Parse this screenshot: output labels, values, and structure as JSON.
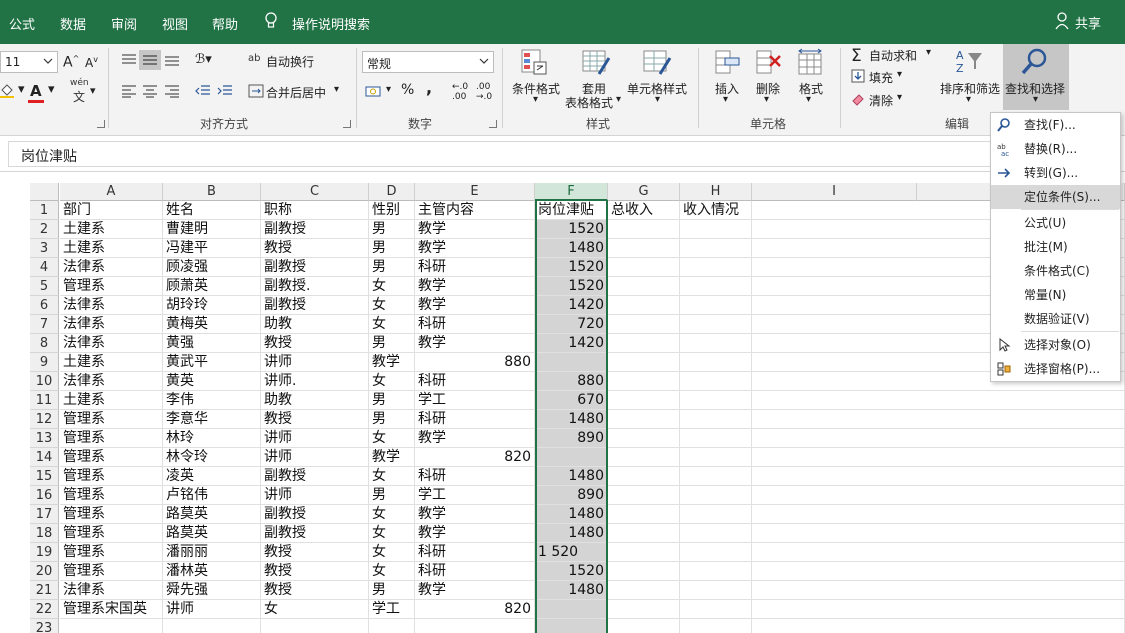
{
  "menu_tabs": [
    "公式",
    "数据",
    "审阅",
    "视图",
    "帮助"
  ],
  "tell_me": "操作说明搜索",
  "share": "共享",
  "ribbon": {
    "font_size": "11",
    "wen_label": "wén",
    "wrap_text": "自动换行",
    "merge_center": "合并后居中",
    "align_group": "对齐方式",
    "number_format": "常规",
    "percent": "%",
    "comma": ",",
    "number_group": "数字",
    "conditional_format": "条件格式",
    "table_format_1": "套用",
    "table_format_2": "表格格式",
    "cell_styles": "单元格样式",
    "styles_group": "样式",
    "insert": "插入",
    "delete": "删除",
    "format": "格式",
    "cells_group": "单元格",
    "autosum": "自动求和",
    "fill": "填充",
    "clear": "清除",
    "sort_filter": "排序和筛选",
    "find_select": "查找和选择",
    "edit_group": "编辑"
  },
  "formula_bar": {
    "value": "岗位津贴"
  },
  "columns": [
    "A",
    "B",
    "C",
    "D",
    "E",
    "F",
    "G",
    "H",
    "I"
  ],
  "rows": [
    [
      "部门",
      "姓名",
      "职称",
      "性别",
      "主管内容",
      "岗位津贴",
      "总收入",
      "收入情况"
    ],
    [
      "土建系",
      "曹建明",
      "副教授",
      "男",
      "教学",
      "1520",
      "",
      ""
    ],
    [
      "土建系",
      "冯建平",
      "教授",
      "男",
      "教学",
      "1480",
      "",
      ""
    ],
    [
      "法律系",
      "顾凌强",
      "副教授",
      "男",
      "科研",
      "1520",
      "",
      ""
    ],
    [
      "管理系",
      "顾萧英",
      "副教授.",
      "女",
      "教学",
      "1520",
      "",
      ""
    ],
    [
      "法律系",
      "胡玲玲",
      "副教授",
      "女",
      "教学",
      "1420",
      "",
      ""
    ],
    [
      "法律系",
      "黄梅英",
      "助教",
      "女",
      "科研",
      "720",
      "",
      ""
    ],
    [
      "法律系",
      "黄强",
      "教授",
      "男",
      "教学",
      "1420",
      "",
      ""
    ],
    [
      "土建系",
      "黄武平",
      "讲师",
      "教学",
      "880",
      "",
      "",
      ""
    ],
    [
      "法律系",
      "黄英",
      "讲师.",
      "女",
      "科研",
      "880",
      "",
      ""
    ],
    [
      "土建系",
      "李伟",
      "助教",
      "男",
      "学工",
      "670",
      "",
      ""
    ],
    [
      "管理系",
      "李意华",
      "教授",
      "男",
      "科研",
      "1480",
      "",
      ""
    ],
    [
      "管理系",
      "林玲",
      "讲师",
      "女",
      "教学",
      "890",
      "",
      ""
    ],
    [
      "管理系",
      "林令玲",
      "讲师",
      "教学",
      "820",
      "",
      "",
      ""
    ],
    [
      "管理系",
      "凌英",
      "副教授",
      "女",
      "科研",
      "1480",
      "",
      ""
    ],
    [
      "管理系",
      "卢铭伟",
      "讲师",
      "男",
      "学工",
      "890",
      "",
      ""
    ],
    [
      "管理系",
      "路莫英",
      "副教授",
      "女",
      "教学",
      "1480",
      "",
      ""
    ],
    [
      "管理系",
      "路莫英",
      "副教授",
      "女",
      "教学",
      "1480",
      "",
      ""
    ],
    [
      "管理系",
      "潘丽丽",
      "教授",
      "女",
      "科研",
      "1 520",
      "",
      ""
    ],
    [
      "管理系",
      "潘林英",
      "教授",
      "女",
      "科研",
      "1520",
      "",
      ""
    ],
    [
      "法律系",
      "舜先强",
      "教授",
      "男",
      "教学",
      "1480",
      "",
      ""
    ],
    [
      "管理系宋国英",
      "讲师",
      "女",
      "学工",
      "820",
      "",
      "",
      ""
    ],
    [
      "",
      "",
      "",
      "",
      "",
      "",
      "",
      ""
    ]
  ],
  "row_numbers": [
    "1",
    "2",
    "3",
    "4",
    "5",
    "6",
    "7",
    "8",
    "9",
    "10",
    "11",
    "12",
    "13",
    "14",
    "15",
    "16",
    "17",
    "18",
    "19",
    "20",
    "21",
    "22",
    "23"
  ],
  "dropdown": {
    "items": [
      "查找(F)...",
      "替换(R)...",
      "转到(G)...",
      "定位条件(S)...",
      "公式(U)",
      "批注(M)",
      "条件格式(C)",
      "常量(N)",
      "数据验证(V)",
      "选择对象(O)",
      "选择窗格(P)..."
    ]
  },
  "colors": {
    "accent": "#217346",
    "selection": "#d4d4d4"
  }
}
